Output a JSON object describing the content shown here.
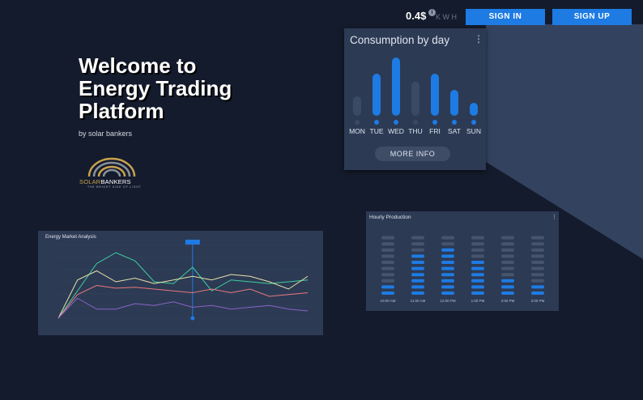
{
  "topbar": {
    "price": "0.4$",
    "unit": "KWH",
    "sign_in": "SIGN IN",
    "sign_up": "SIGN UP"
  },
  "hero": {
    "title": "Welcome to Energy Trading Platform",
    "subtitle": "by solar bankers"
  },
  "logo": {
    "word_a": "SOLAR",
    "word_b": "BANKERS",
    "tagline": "THE BRIGHT SIDE OF LIGHT"
  },
  "consumption": {
    "title": "Consumption by day",
    "more_label": "MORE INFO"
  },
  "market": {
    "title": "Energy Market Analysis"
  },
  "hourly": {
    "title": "Hourly Production"
  },
  "colors": {
    "background": "#141b2c",
    "card": "#2c3a54",
    "accent": "#1e7be3",
    "bar_dim": "#3a4a64",
    "line_green": "#3ecf9c",
    "line_yellow": "#e8e2a8",
    "line_red": "#e9787c",
    "line_purple": "#8a63c5"
  },
  "chart_data": [
    {
      "type": "bar",
      "title": "Consumption by day",
      "categories": [
        "MON",
        "TUE",
        "WED",
        "THU",
        "FRI",
        "SAT",
        "SUN"
      ],
      "values": [
        3,
        6.5,
        9,
        5.3,
        6.5,
        4,
        2
      ],
      "highlighted": [
        false,
        true,
        true,
        false,
        true,
        true,
        true
      ]
    },
    {
      "type": "line",
      "title": "Energy Market Analysis",
      "x": [
        1,
        2,
        3,
        4,
        5,
        6,
        7,
        8,
        9,
        10,
        11,
        12,
        13,
        14
      ],
      "series": [
        {
          "color": "#3ecf9c",
          "values": [
            0,
            30,
            60,
            72,
            63,
            40,
            38,
            56,
            30,
            42,
            40,
            38,
            40,
            42
          ]
        },
        {
          "color": "#e8e2a8",
          "values": [
            0,
            42,
            52,
            40,
            44,
            38,
            42,
            46,
            42,
            48,
            46,
            40,
            32,
            46
          ]
        },
        {
          "color": "#e9787c",
          "values": [
            0,
            26,
            36,
            33,
            34,
            32,
            30,
            28,
            32,
            28,
            32,
            24,
            26,
            28
          ]
        },
        {
          "color": "#8a63c5",
          "values": [
            0,
            22,
            10,
            10,
            16,
            14,
            18,
            12,
            14,
            10,
            12,
            14,
            10,
            8
          ]
        }
      ],
      "highlighted_index": 7
    },
    {
      "type": "bar",
      "title": "Hourly Production",
      "categories": [
        "10:00 AM",
        "11:00 AM",
        "12:00 PM",
        "1:00 PM",
        "2:00 PM",
        "3:00 PM"
      ],
      "values": [
        2,
        7,
        8,
        6,
        3,
        2
      ],
      "max": 10
    }
  ]
}
